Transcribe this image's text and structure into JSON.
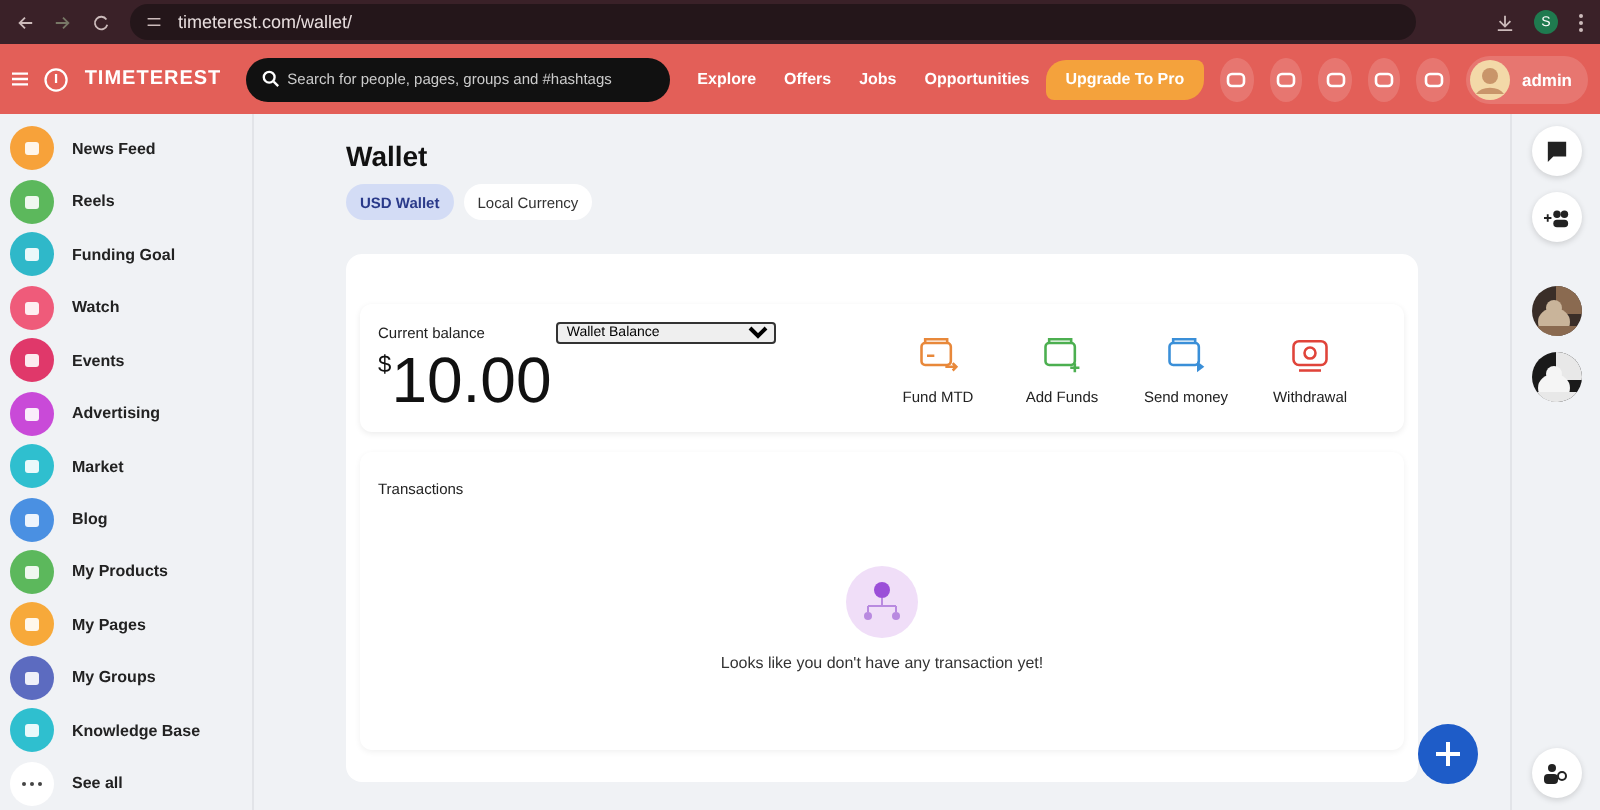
{
  "browser": {
    "url": "timeterest.com/wallet/",
    "profile_initial": "S"
  },
  "header": {
    "logo_text": "TIMETEREST",
    "search": {
      "placeholder": "Search for people, pages, groups and #hashtags"
    },
    "nav": [
      "Explore",
      "Offers",
      "Jobs",
      "Opportunities"
    ],
    "upgrade": "Upgrade To Pro",
    "user": "admin"
  },
  "sidebar": {
    "items": [
      {
        "label": "News Feed",
        "color": "#f7a23a"
      },
      {
        "label": "Reels",
        "color": "#5cb85c"
      },
      {
        "label": "Funding Goal",
        "color": "#2fb8c9"
      },
      {
        "label": "Watch",
        "color": "#ef5b7a"
      },
      {
        "label": "Events",
        "color": "#e0386a"
      },
      {
        "label": "Advertising",
        "color": "#c94ad8"
      },
      {
        "label": "Market",
        "color": "#2fbfcf"
      },
      {
        "label": "Blog",
        "color": "#4a90e2"
      },
      {
        "label": "My Products",
        "color": "#5cb85c"
      },
      {
        "label": "My Pages",
        "color": "#f7a93a"
      },
      {
        "label": "My Groups",
        "color": "#5c6bc0"
      },
      {
        "label": "Knowledge Base",
        "color": "#2fbfcf"
      },
      {
        "label": "See all",
        "color": "#ffffff"
      }
    ]
  },
  "wallet": {
    "title": "Wallet",
    "tabs": [
      {
        "label": "USD Wallet",
        "selected": true
      },
      {
        "label": "Local Currency",
        "selected": false
      }
    ],
    "balance_label": "Current balance",
    "balance_select": "Wallet Balance",
    "currency": "$",
    "amount": "10.00",
    "actions": [
      {
        "label": "Fund MTD",
        "color": "#e8883a"
      },
      {
        "label": "Add Funds",
        "color": "#4caf50"
      },
      {
        "label": "Send money",
        "color": "#3a8fd8"
      },
      {
        "label": "Withdrawal",
        "color": "#e0443a"
      }
    ],
    "transactions_title": "Transactions",
    "empty_message": "Looks like you don't have any transaction yet!"
  }
}
